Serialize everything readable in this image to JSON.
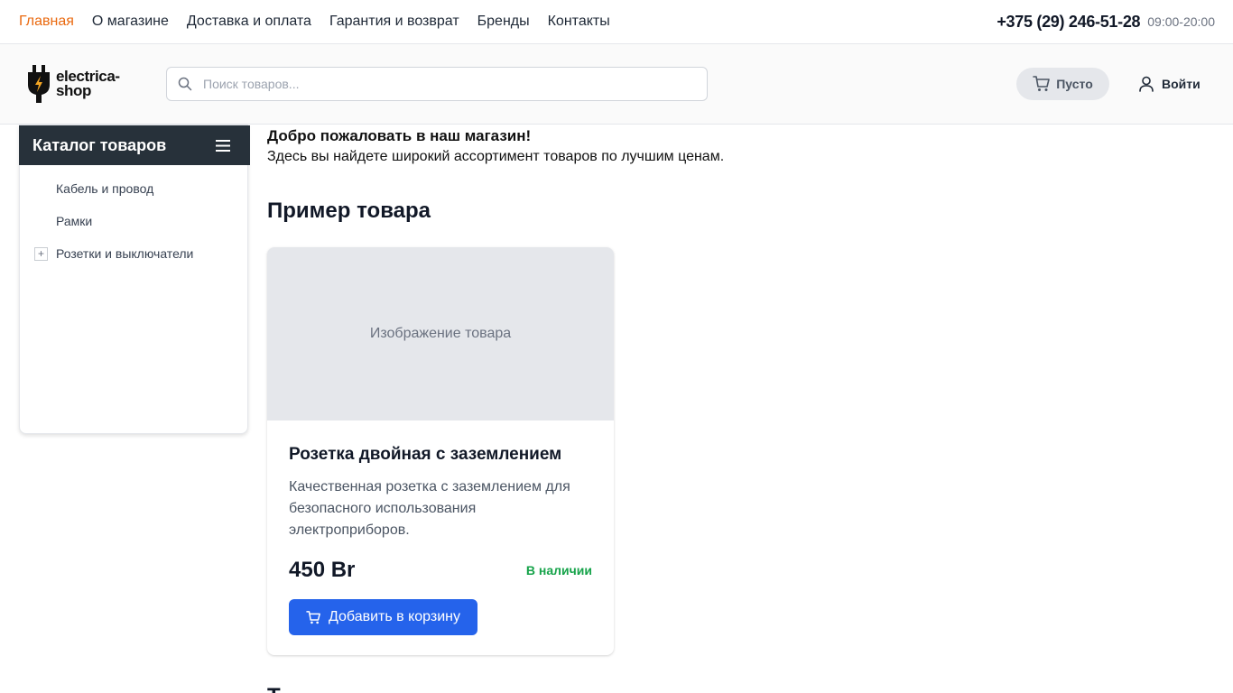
{
  "topnav": {
    "items": [
      {
        "label": "Главная",
        "active": true
      },
      {
        "label": "О магазине"
      },
      {
        "label": "Доставка и оплата"
      },
      {
        "label": "Гарантия и возврат"
      },
      {
        "label": "Бренды"
      },
      {
        "label": "Контакты"
      }
    ],
    "phone": "+375 (29) 246-51-28",
    "hours": "09:00-20:00"
  },
  "header": {
    "logo_line1": "electrica-",
    "logo_line2": "shop",
    "search_placeholder": "Поиск товаров...",
    "cart_label": "Пусто",
    "login_label": "Войти"
  },
  "sidebar": {
    "title": "Каталог товаров",
    "items": [
      {
        "label": "Кабель и провод",
        "expandable": false
      },
      {
        "label": "Рамки",
        "expandable": false
      },
      {
        "label": "Розетки и выключатели",
        "expandable": true
      }
    ]
  },
  "main": {
    "welcome": "Добро пожаловать в наш магазин!",
    "subtext": "Здесь вы найдете широкий ассортимент товаров по лучшим ценам.",
    "section_title": "Пример товара",
    "product": {
      "image_placeholder": "Изображение товара",
      "title": "Розетка двойная с заземлением",
      "description": "Качественная розетка с заземлением для безопасного использования электроприборов.",
      "price": "450 Br",
      "stock": "В наличии",
      "add_button": "Добавить в корзину"
    },
    "next_section_title": "Т"
  },
  "colors": {
    "accent": "#ea6a10",
    "primary_button": "#2563eb",
    "sidebar_header": "#27313a",
    "in_stock": "#16a34a"
  },
  "icons": [
    "search-icon",
    "cart-icon",
    "user-icon",
    "menu-icon",
    "plus-icon",
    "logo-plug-icon"
  ]
}
